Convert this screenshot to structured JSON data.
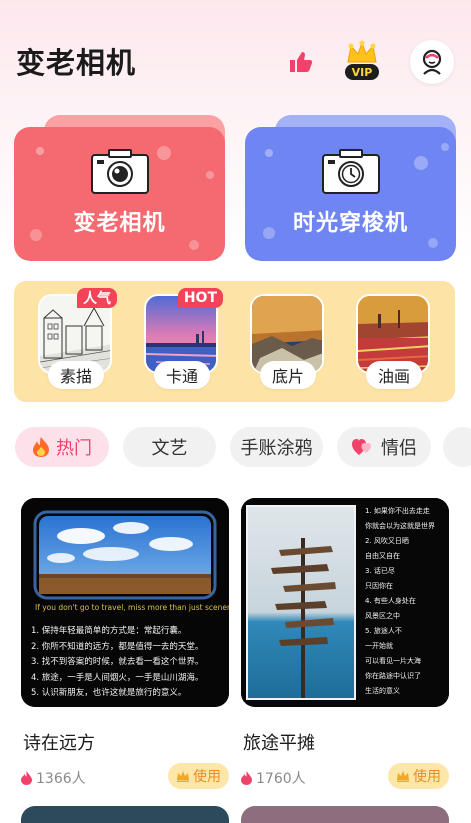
{
  "header": {
    "title": "变老相机",
    "like_icon": "thumbs-up-icon",
    "vip_badge": "VIP",
    "avatar_icon": "user-avatar-icon"
  },
  "cards": [
    {
      "label": "变老相机",
      "icon": "camera-icon",
      "color": "#f97b80"
    },
    {
      "label": "时光穿梭机",
      "icon": "clock-camera-icon",
      "color": "#7c92f3"
    }
  ],
  "styles": [
    {
      "label": "素描",
      "badge": "人气"
    },
    {
      "label": "卡通",
      "badge": "HOT"
    },
    {
      "label": "底片",
      "badge": ""
    },
    {
      "label": "油画",
      "badge": ""
    }
  ],
  "tabs": [
    {
      "label": "热门",
      "icon": "fire-icon",
      "active": true
    },
    {
      "label": "文艺",
      "active": false
    },
    {
      "label": "手账涂鸦",
      "active": false
    },
    {
      "label": "情侣",
      "icon": "hearts-icon",
      "active": false
    }
  ],
  "templates": [
    {
      "title": "诗在远方",
      "count": "1366人",
      "use_label": "使用",
      "caption_en": "If you don't go to travel, miss more than just scenery",
      "lines": [
        "1. 保持年轻最简单的方式是：常起行囊。",
        "2. 你所不知道的远方，都是值得一去的天堂。",
        "3. 找不到答案的时候，就去看一看这个世界。",
        "4. 旅途，一手是人间烟火，一手是山川湖海。",
        "5. 认识新朋友，也许这就是旅行的意义。"
      ]
    },
    {
      "title": "旅途平摊",
      "count": "1760人",
      "use_label": "使用",
      "lines": [
        "1. 如果你不出去走走",
        "你就会以为这就是世界",
        "2. 风吹又日晒",
        "自由又自在",
        "3. 话已尽",
        "只因你在",
        "4. 有些人身处在",
        "风景区之中",
        "5. 旅途人不",
        "一开始就",
        "可以看见一片大海",
        "你在路途中认识了",
        "生活的意义"
      ]
    }
  ]
}
